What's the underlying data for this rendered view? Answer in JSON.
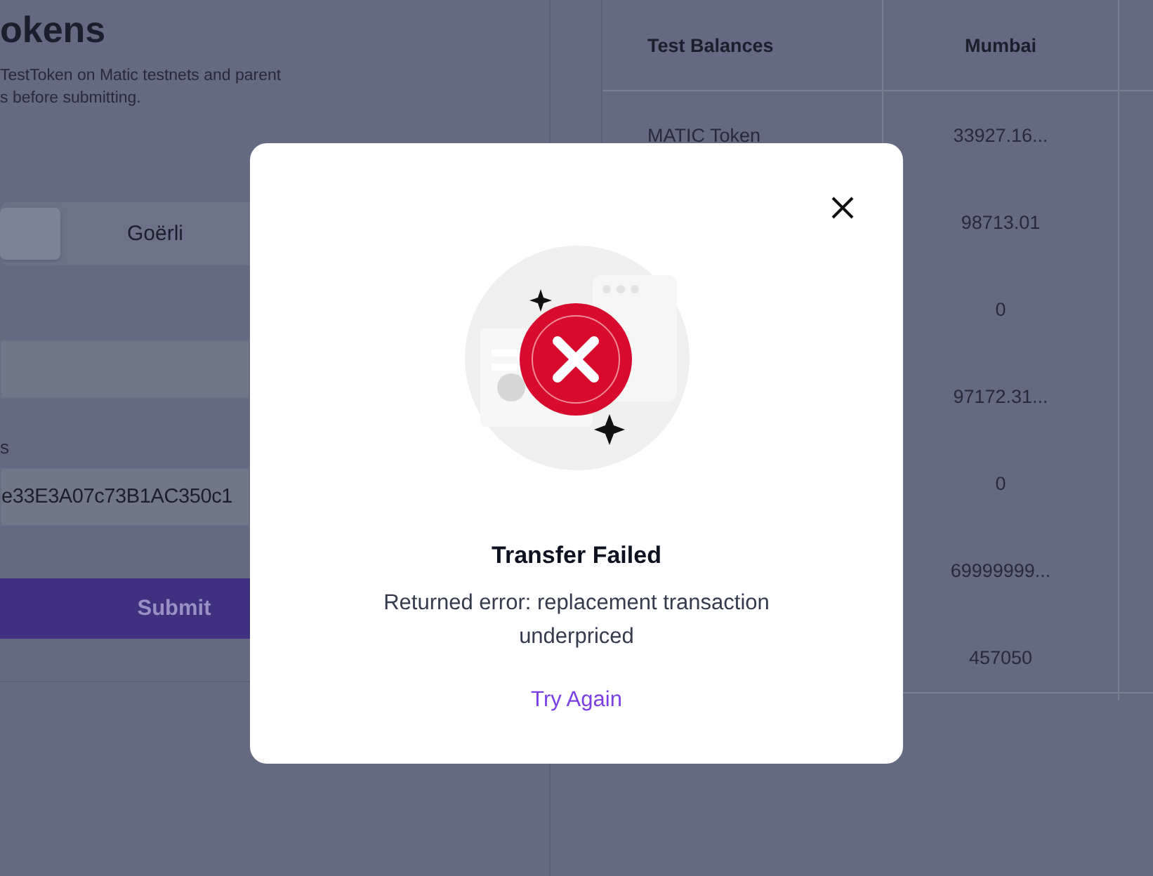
{
  "form": {
    "title": "okens",
    "description": [
      "TestToken on Matic testnets and parent",
      "s before submitting."
    ],
    "network_tabs": [
      {
        "selected": true
      },
      {
        "label": "Goërli",
        "selected": false
      }
    ],
    "fields": [
      {
        "kind": "blank"
      },
      {
        "kind": "filled",
        "label": "s",
        "value": "e33E3A07c73B1AC350c1"
      }
    ],
    "submit_button": "Submit"
  },
  "balances_table": {
    "columns": [
      "Test Balances",
      "Mumbai"
    ],
    "rows": [
      {
        "token": "MATIC Token",
        "mumbai": "33927.16..."
      },
      {
        "mumbai": "98713.01"
      },
      {
        "mumbai": "0"
      },
      {
        "mumbai": "97172.31..."
      },
      {
        "mumbai": "0"
      },
      {
        "mumbai": "69999999..."
      },
      {
        "mumbai": "457050"
      }
    ]
  },
  "modal": {
    "title": "Transfer Failed",
    "message": "Returned error: replacement transaction underpriced",
    "action": "Try Again"
  }
}
